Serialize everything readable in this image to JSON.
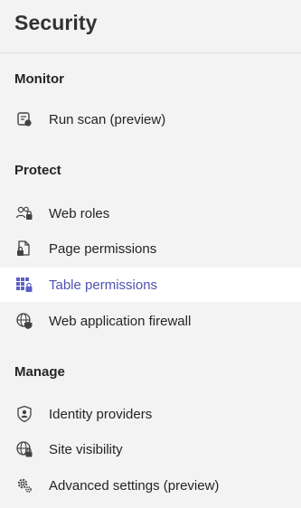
{
  "app": {
    "title": "Security"
  },
  "sections": [
    {
      "label": "Monitor",
      "items": [
        {
          "label": "Run scan (preview)",
          "icon": "scan-document-icon",
          "selected": false
        }
      ]
    },
    {
      "label": "Protect",
      "items": [
        {
          "label": "Web roles",
          "icon": "people-lock-icon",
          "selected": false
        },
        {
          "label": "Page permissions",
          "icon": "document-lock-icon",
          "selected": false
        },
        {
          "label": "Table permissions",
          "icon": "table-lock-icon",
          "selected": true
        },
        {
          "label": "Web application firewall",
          "icon": "globe-shield-icon",
          "selected": false
        }
      ]
    },
    {
      "label": "Manage",
      "items": [
        {
          "label": "Identity providers",
          "icon": "shield-person-icon",
          "selected": false
        },
        {
          "label": "Site visibility",
          "icon": "globe-lock-icon",
          "selected": false
        },
        {
          "label": "Advanced settings (preview)",
          "icon": "settings-cog-icon",
          "selected": false
        }
      ]
    }
  ],
  "colors": {
    "panel_background": "#f3f3f3",
    "selected_background": "#ffffff",
    "selected_text": "#4f52b2",
    "text": "#242424"
  }
}
